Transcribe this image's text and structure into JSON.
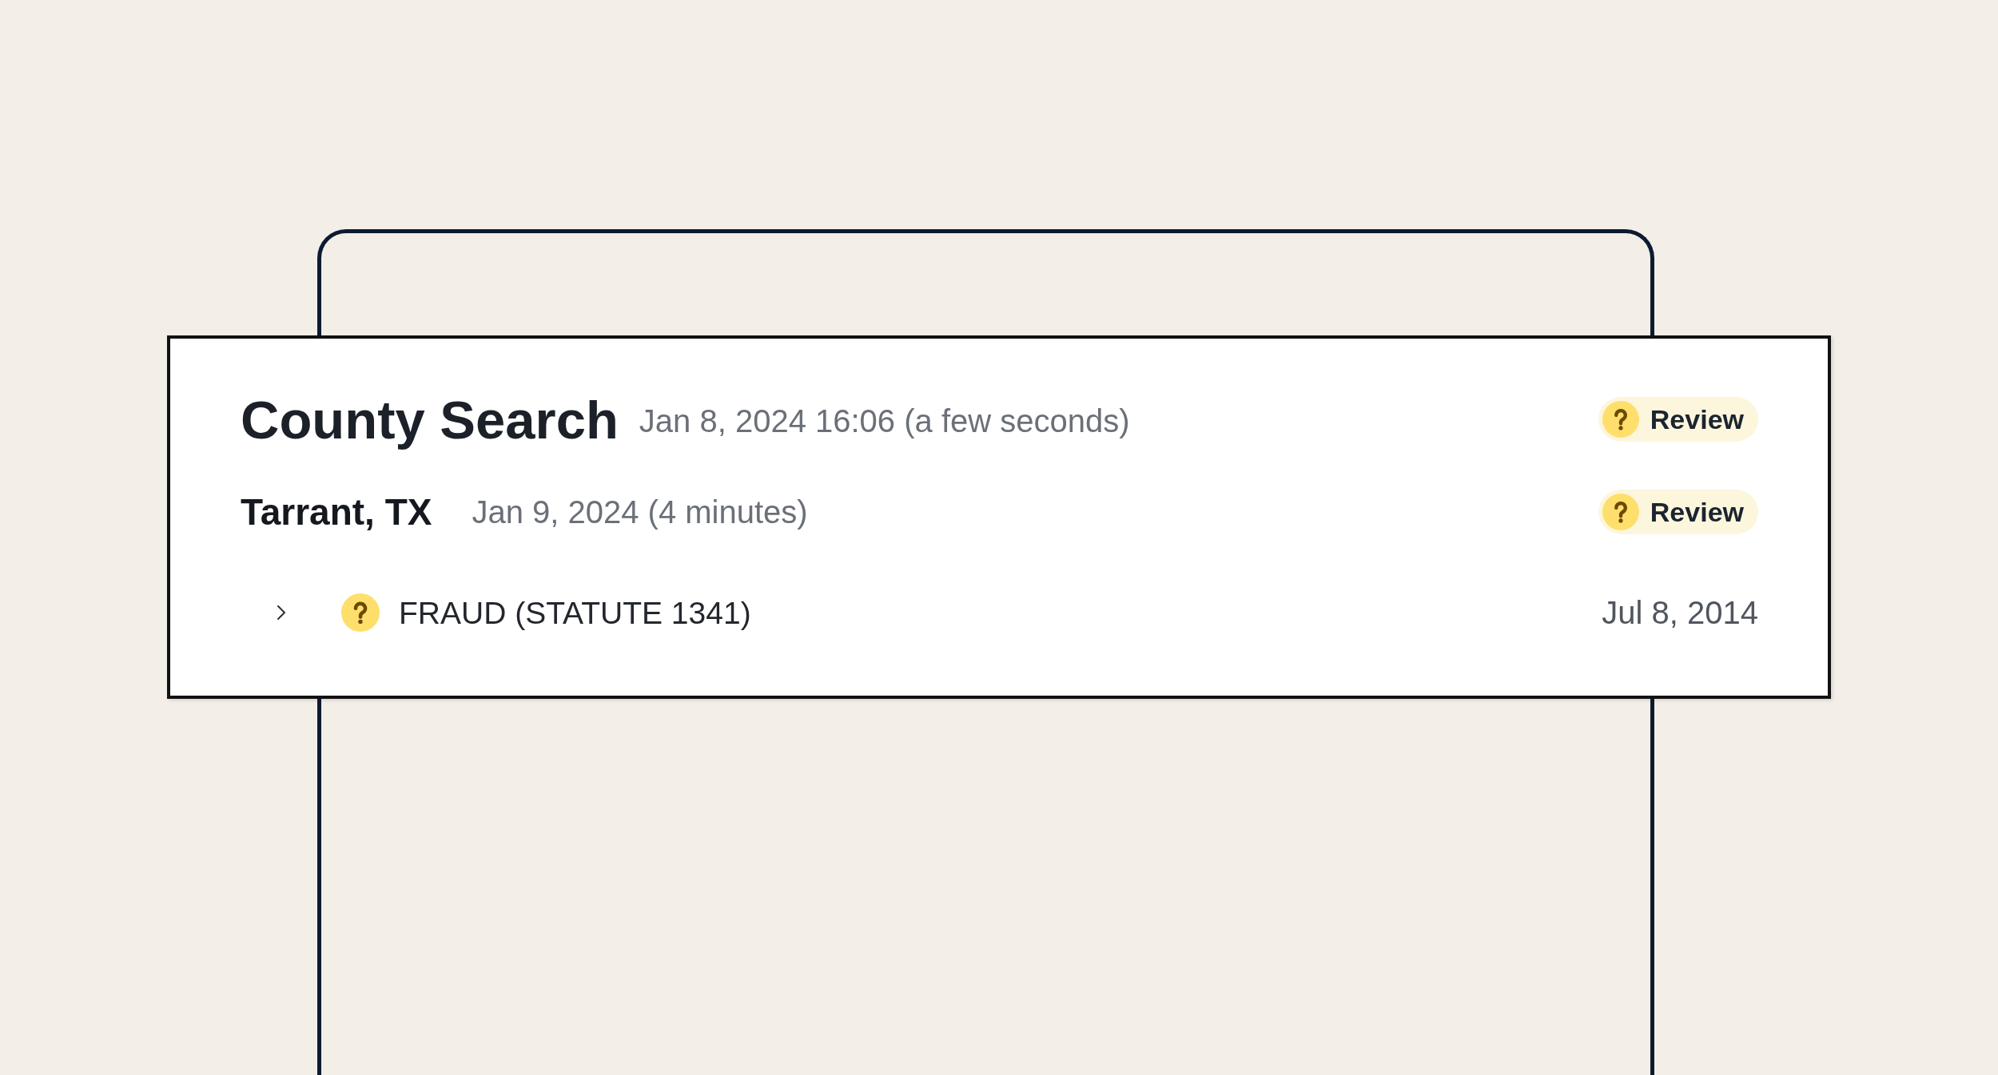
{
  "search": {
    "title": "County Search",
    "timestamp": "Jan 8, 2024 16:06 (a few seconds)",
    "status": {
      "kind": "review",
      "label": "Review"
    }
  },
  "counties": [
    {
      "name": "Tarrant, TX",
      "timestamp": "Jan 9, 2024 (4 minutes)",
      "status": {
        "kind": "review",
        "label": "Review"
      },
      "records": [
        {
          "title": "FRAUD (STATUTE 1341)",
          "date": "Jul 8, 2014",
          "expanded": false,
          "status": {
            "kind": "review"
          }
        }
      ]
    }
  ]
}
